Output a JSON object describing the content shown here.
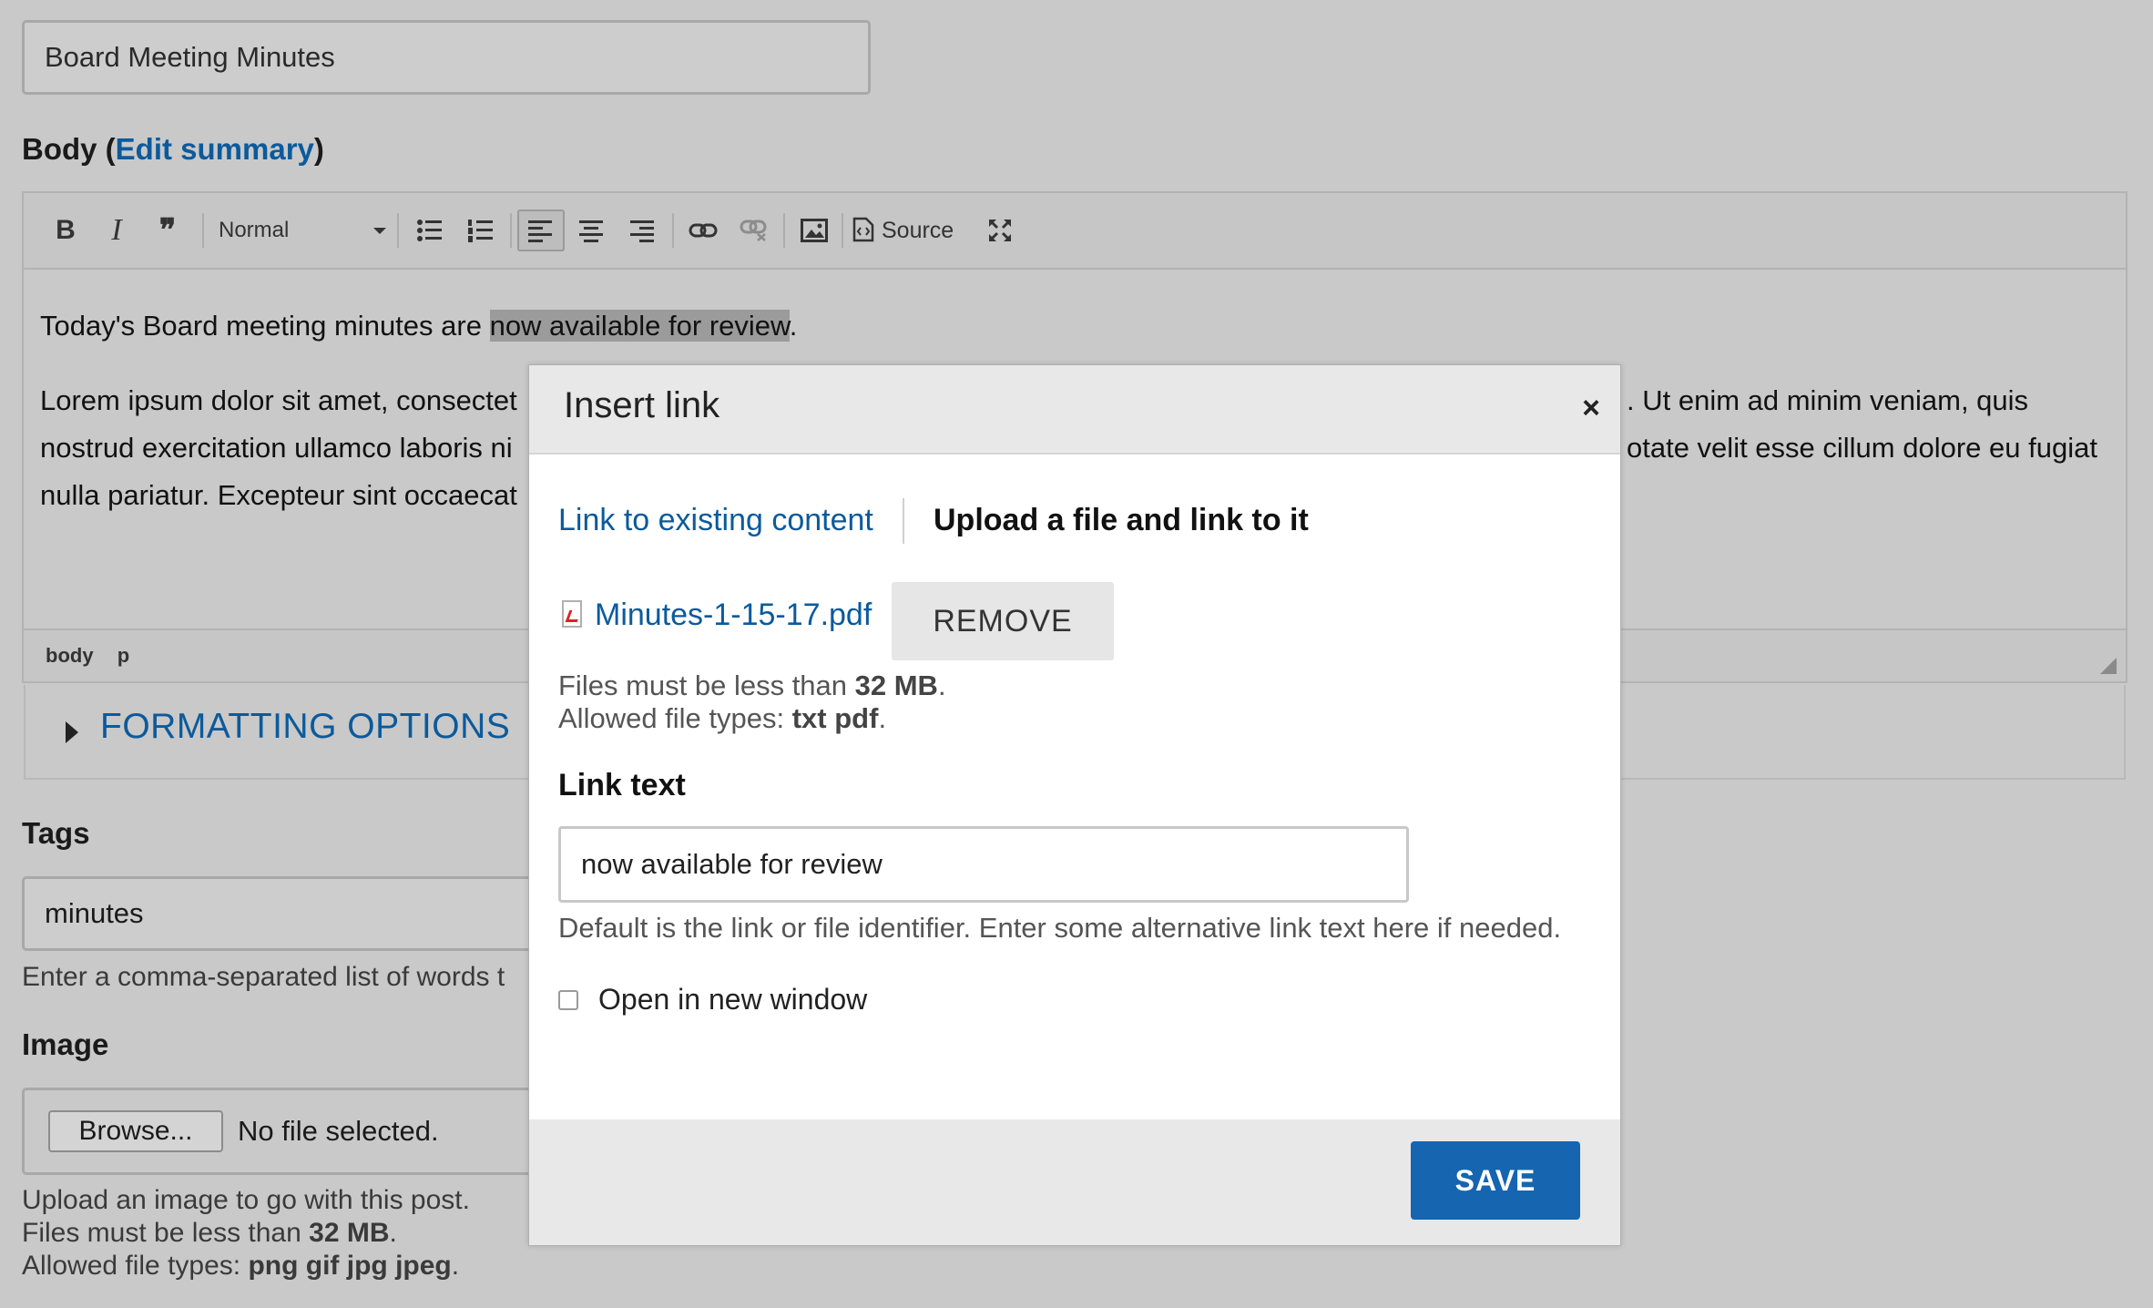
{
  "form": {
    "title_value": "Board Meeting Minutes",
    "body_label": "Body",
    "edit_summary_link": "Edit summary",
    "tags_label": "Tags",
    "tags_value": "minutes",
    "tags_help": "Enter a comma-separated list of words t",
    "image_label": "Image",
    "browse_button": "Browse...",
    "no_file": "No file selected.",
    "image_help_1": "Upload an image to go with this post.",
    "image_help_2_prefix": "Files must be less than ",
    "image_help_2_size": "32 MB",
    "image_help_2_suffix": ".",
    "image_help_3_prefix": "Allowed file types: ",
    "image_help_3_types": "png gif jpg jpeg",
    "image_help_3_suffix": "."
  },
  "editor": {
    "toolbar": {
      "bold": "B",
      "italic": "I",
      "quote": "❞",
      "format_select": "Normal",
      "source_label": "Source"
    },
    "content": {
      "p1_before": "Today's Board meeting minutes are ",
      "p1_highlight": "now available for review",
      "p1_after": ".",
      "p2_line1_left": "Lorem ipsum dolor sit amet, consectet",
      "p2_line1_right": ". Ut enim ad minim veniam, quis",
      "p2_line2_left": "nostrud exercitation ullamco laboris ni",
      "p2_line2_right": "otate velit esse cillum dolore eu fugiat",
      "p2_line3_left": "nulla pariatur. Excepteur sint occaecat"
    },
    "status_path": [
      "body",
      "p"
    ]
  },
  "formatting_options": "FORMATTING OPTIONS",
  "modal": {
    "title": "Insert link",
    "close": "×",
    "tab_existing": "Link to existing content",
    "tab_upload": "Upload a file and link to it",
    "file_name": "Minutes-1-15-17.pdf",
    "remove_button": "REMOVE",
    "size_help_prefix": "Files must be less than ",
    "size_help_value": "32 MB",
    "size_help_suffix": ".",
    "types_help_prefix": "Allowed file types: ",
    "types_help_value": "txt pdf",
    "types_help_suffix": ".",
    "link_text_label": "Link text",
    "link_text_value": "now available for review",
    "link_text_help": "Default is the link or file identifier. Enter some alternative link text here if needed.",
    "new_window_label": "Open in new window",
    "new_window_checked": false,
    "save_button": "SAVE"
  },
  "colors": {
    "link": "#0b5a9c",
    "save_button": "#1565b0",
    "overlay_background": "#c9c9c9"
  }
}
